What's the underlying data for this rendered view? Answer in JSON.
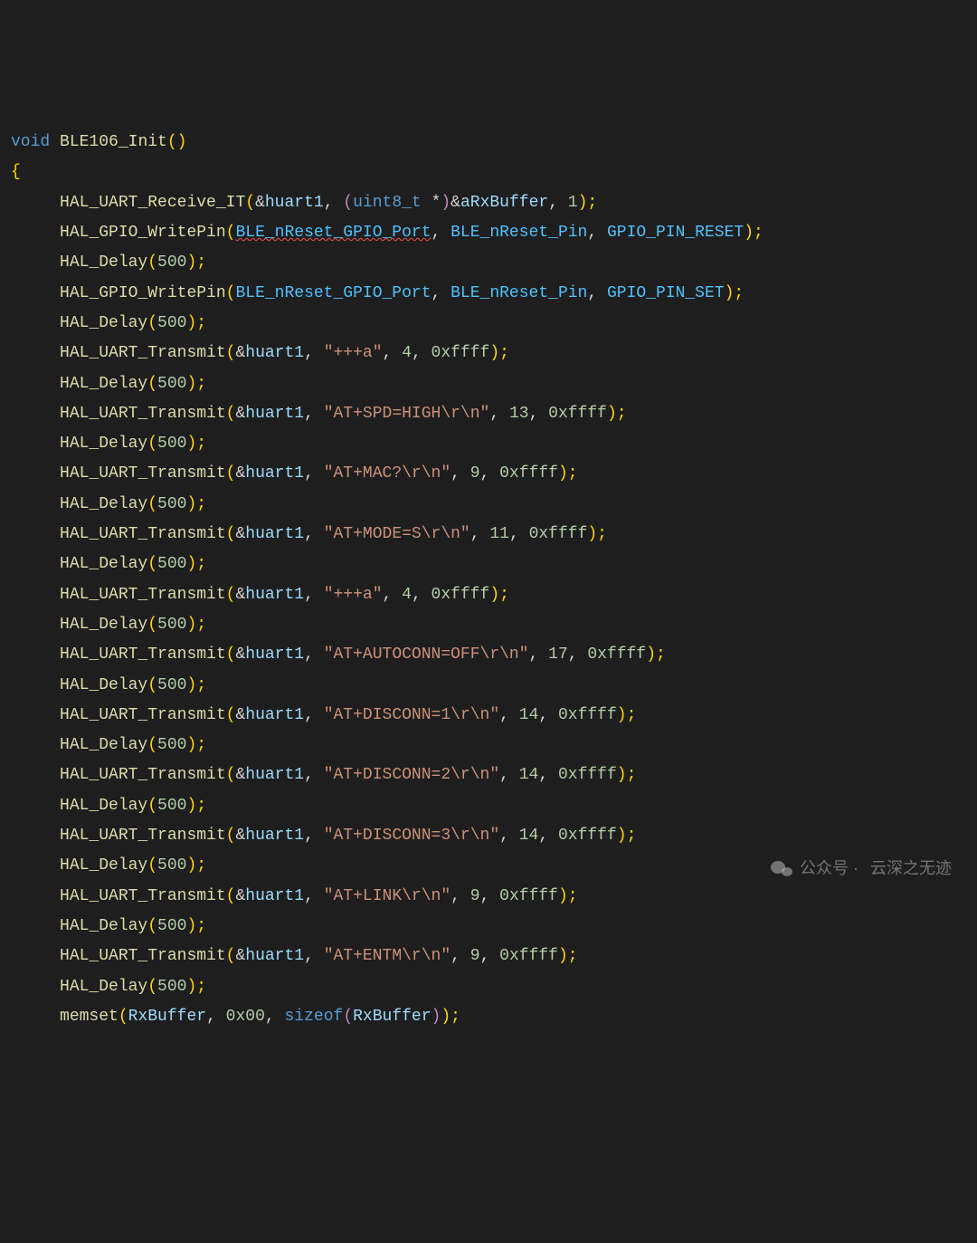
{
  "code": {
    "l0_kw_void": "void",
    "l0_fn": "BLE106_Init",
    "l0_paren": "()",
    "l1_brace": "{",
    "l2": {
      "fn": "HAL_UART_Receive_IT",
      "a_amp": "&",
      "a_var": "huart1",
      "c1": ", ",
      "cast_open": "(",
      "cast_type": "uint8_t ",
      "cast_star": "*",
      "cast_close": ")",
      "amp2": "&",
      "buf": "aRxBuffer",
      "c2": ", ",
      "n": "1",
      "end": ");"
    },
    "l3": {
      "fn": "HAL_GPIO_WritePin",
      "open": "(",
      "a": "BLE_nReset_GPIO_Port",
      "c1": ", ",
      "b": "BLE_nReset_Pin",
      "c2": ", ",
      "c": "GPIO_PIN_RESET",
      "end": ");"
    },
    "l4": {
      "fn": "HAL_Delay",
      "open": "(",
      "n": "500",
      "end": ");"
    },
    "l5": {
      "fn": "HAL_GPIO_WritePin",
      "open": "(",
      "a": "BLE_nReset_GPIO_Port",
      "c1": ", ",
      "b": "BLE_nReset_Pin",
      "c2": ", ",
      "c": "GPIO_PIN_SET",
      "end": ");"
    },
    "l6": {
      "fn": "HAL_Delay",
      "open": "(",
      "n": "500",
      "end": ");"
    },
    "l7": {
      "fn": "HAL_UART_Transmit",
      "open": "(",
      "amp": "&",
      "v": "huart1",
      "c1": ", ",
      "s": "\"+++a\"",
      "c2": ", ",
      "n1": "4",
      "c3": ", ",
      "n2": "0xffff",
      "end": ");"
    },
    "l8": {
      "fn": "HAL_Delay",
      "open": "(",
      "n": "500",
      "end": ");"
    },
    "l9": {
      "fn": "HAL_UART_Transmit",
      "open": "(",
      "amp": "&",
      "v": "huart1",
      "c1": ", ",
      "s": "\"AT+SPD=HIGH\\r\\n\"",
      "c2": ", ",
      "n1": "13",
      "c3": ", ",
      "n2": "0xffff",
      "end": ");"
    },
    "l10": {
      "fn": "HAL_Delay",
      "open": "(",
      "n": "500",
      "end": ");"
    },
    "l11": {
      "fn": "HAL_UART_Transmit",
      "open": "(",
      "amp": "&",
      "v": "huart1",
      "c1": ", ",
      "s": "\"AT+MAC?\\r\\n\"",
      "c2": ", ",
      "n1": "9",
      "c3": ", ",
      "n2": "0xffff",
      "end": ");"
    },
    "l12": {
      "fn": "HAL_Delay",
      "open": "(",
      "n": "500",
      "end": ");"
    },
    "l13": {
      "fn": "HAL_UART_Transmit",
      "open": "(",
      "amp": "&",
      "v": "huart1",
      "c1": ", ",
      "s": "\"AT+MODE=S\\r\\n\"",
      "c2": ", ",
      "n1": "11",
      "c3": ", ",
      "n2": "0xffff",
      "end": ");"
    },
    "l14": {
      "fn": "HAL_Delay",
      "open": "(",
      "n": "500",
      "end": ");"
    },
    "l15": {
      "fn": "HAL_UART_Transmit",
      "open": "(",
      "amp": "&",
      "v": "huart1",
      "c1": ", ",
      "s": "\"+++a\"",
      "c2": ", ",
      "n1": "4",
      "c3": ", ",
      "n2": "0xffff",
      "end": ");"
    },
    "l16": {
      "fn": "HAL_Delay",
      "open": "(",
      "n": "500",
      "end": ");"
    },
    "l17": {
      "fn": "HAL_UART_Transmit",
      "open": "(",
      "amp": "&",
      "v": "huart1",
      "c1": ", ",
      "s": "\"AT+AUTOCONN=OFF\\r\\n\"",
      "c2": ", ",
      "n1": "17",
      "c3": ", ",
      "n2": "0xffff",
      "end": ");"
    },
    "l18": {
      "fn": "HAL_Delay",
      "open": "(",
      "n": "500",
      "end": ");"
    },
    "l19": {
      "fn": "HAL_UART_Transmit",
      "open": "(",
      "amp": "&",
      "v": "huart1",
      "c1": ", ",
      "s": "\"AT+DISCONN=1\\r\\n\"",
      "c2": ", ",
      "n1": "14",
      "c3": ", ",
      "n2": "0xffff",
      "end": ");"
    },
    "l20": {
      "fn": "HAL_Delay",
      "open": "(",
      "n": "500",
      "end": ");"
    },
    "l21": {
      "fn": "HAL_UART_Transmit",
      "open": "(",
      "amp": "&",
      "v": "huart1",
      "c1": ", ",
      "s": "\"AT+DISCONN=2\\r\\n\"",
      "c2": ", ",
      "n1": "14",
      "c3": ", ",
      "n2": "0xffff",
      "end": ");"
    },
    "l22": {
      "fn": "HAL_Delay",
      "open": "(",
      "n": "500",
      "end": ");"
    },
    "l23": {
      "fn": "HAL_UART_Transmit",
      "open": "(",
      "amp": "&",
      "v": "huart1",
      "c1": ", ",
      "s": "\"AT+DISCONN=3\\r\\n\"",
      "c2": ", ",
      "n1": "14",
      "c3": ", ",
      "n2": "0xffff",
      "end": ");"
    },
    "l24": {
      "fn": "HAL_Delay",
      "open": "(",
      "n": "500",
      "end": ");"
    },
    "l25": {
      "fn": "HAL_UART_Transmit",
      "open": "(",
      "amp": "&",
      "v": "huart1",
      "c1": ", ",
      "s": "\"AT+LINK\\r\\n\"",
      "c2": ", ",
      "n1": "9",
      "c3": ", ",
      "n2": "0xffff",
      "end": ");"
    },
    "l26": {
      "fn": "HAL_Delay",
      "open": "(",
      "n": "500",
      "end": ");"
    },
    "l27": {
      "fn": "HAL_UART_Transmit",
      "open": "(",
      "amp": "&",
      "v": "huart1",
      "c1": ", ",
      "s": "\"AT+ENTM\\r\\n\"",
      "c2": ", ",
      "n1": "9",
      "c3": ", ",
      "n2": "0xffff",
      "end": ");"
    },
    "l28": {
      "fn": "HAL_Delay",
      "open": "(",
      "n": "500",
      "end": ");"
    },
    "l29": {
      "fn": "memset",
      "open": "(",
      "a": "RxBuffer",
      "c1": ", ",
      "n": "0x00",
      "c2": ", ",
      "sz": "sizeof",
      "open2": "(",
      "b": "RxBuffer",
      "close2": ")",
      "end": ");"
    }
  },
  "watermark": {
    "prefix": "公众号 · ",
    "text": "云深之无迹"
  }
}
